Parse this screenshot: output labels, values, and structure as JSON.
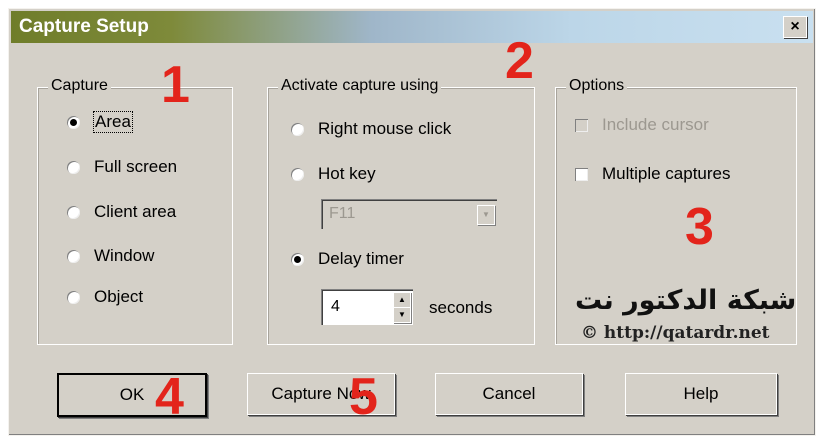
{
  "window": {
    "title": "Capture Setup",
    "close": "×"
  },
  "capture": {
    "label": "Capture",
    "options": [
      {
        "label": "Area",
        "selected": true
      },
      {
        "label": "Full screen",
        "selected": false
      },
      {
        "label": "Client area",
        "selected": false
      },
      {
        "label": "Window",
        "selected": false
      },
      {
        "label": "Object",
        "selected": false
      }
    ]
  },
  "activate": {
    "label": "Activate capture using",
    "right_click": "Right mouse click",
    "hot_key": "Hot key",
    "hot_key_value": "F11",
    "delay_timer": "Delay timer",
    "delay_value": "4",
    "seconds": "seconds"
  },
  "options": {
    "label": "Options",
    "include_cursor": "Include cursor",
    "multiple_captures": "Multiple captures"
  },
  "buttons": {
    "ok": "OK",
    "capture_now": "Capture Now",
    "cancel": "Cancel",
    "help": "Help"
  },
  "annotations": [
    "1",
    "2",
    "3",
    "4",
    "5"
  ],
  "watermark": {
    "arabic": "شبكة الدكتور نت",
    "url": "http://qatardr.net"
  },
  "colors": {
    "annotation": "#e3241b",
    "dialog": "#d4d0c8"
  }
}
